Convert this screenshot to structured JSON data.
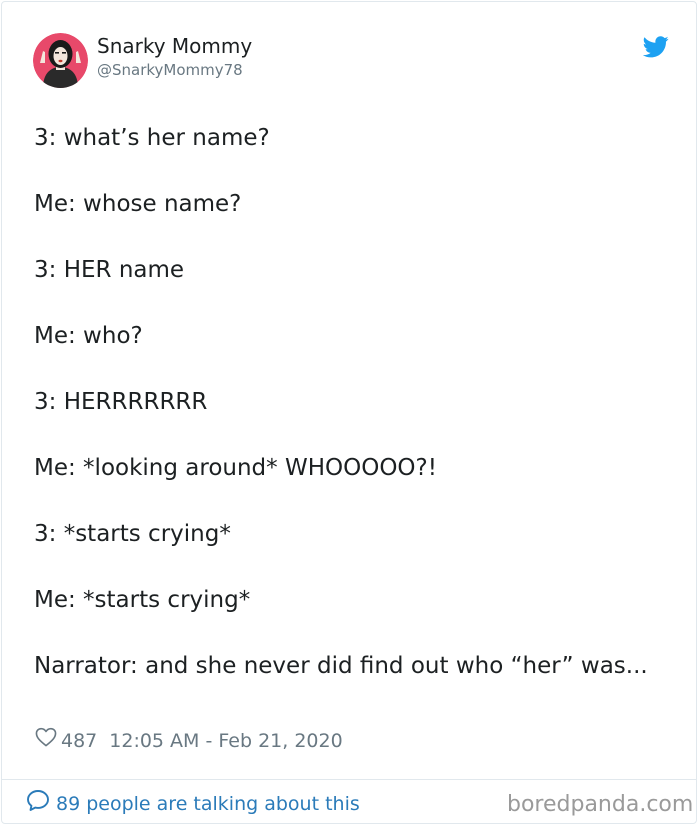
{
  "tweet": {
    "display_name": "Snarky Mommy",
    "handle": "@SnarkyMommy78",
    "body_lines": [
      "3: what’s her name?",
      "Me: whose name?",
      "3: HER name",
      "Me: who?",
      "3: HERRRRRRR",
      "Me: *looking around* WHOOOOO?!",
      "3: *starts crying*",
      "Me: *starts crying*",
      "Narrator: and she never did find out who “her” was..."
    ],
    "likes": "487",
    "timestamp": "12:05 AM - Feb 21, 2020",
    "talking_link": "89 people are talking about this"
  },
  "icons": {
    "brand": "twitter-bird-icon",
    "like": "heart-icon",
    "reply": "speech-bubble-icon"
  },
  "colors": {
    "twitter_blue": "#1da1f2",
    "link_blue": "#2b7bb9",
    "secondary_text": "#697882",
    "avatar_ring": "#e8496a"
  },
  "watermark": "boredpanda.com"
}
